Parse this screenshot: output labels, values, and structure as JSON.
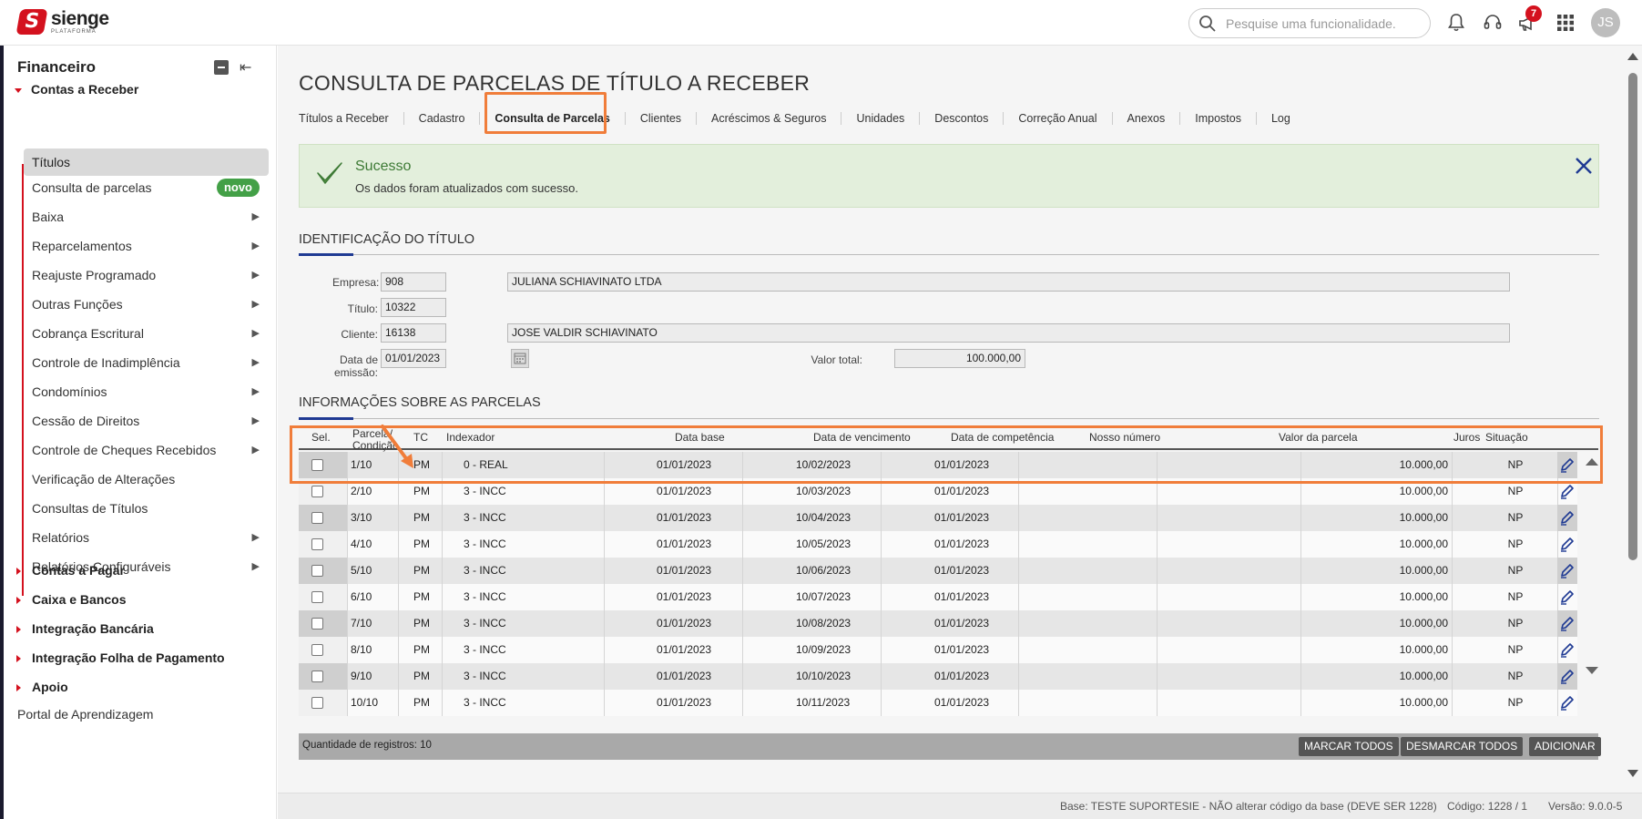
{
  "brand": {
    "name": "sienge",
    "sub": "PLATAFORMA",
    "mark": "S"
  },
  "header": {
    "search_placeholder": "Pesquise uma funcionalidade.",
    "notifications_badge": "7",
    "avatar_initials": "JS",
    "accent_color": "#d4111e"
  },
  "sidebar": {
    "title": "Financeiro",
    "sections": {
      "contas_receber": "Contas a Receber",
      "contas_pagar": "Contas a Pagar",
      "caixa_bancos": "Caixa e Bancos",
      "integracao_bancaria": "Integração Bancária",
      "integracao_folha": "Integração Folha de Pagamento",
      "apoio": "Apoio"
    },
    "items": [
      {
        "label": "Títulos",
        "active": true
      },
      {
        "label": "Consulta de parcelas",
        "badge": "novo"
      },
      {
        "label": "Baixa",
        "submenu": true
      },
      {
        "label": "Reparcelamentos",
        "submenu": true
      },
      {
        "label": "Reajuste Programado",
        "submenu": true
      },
      {
        "label": "Outras Funções",
        "submenu": true
      },
      {
        "label": "Cobrança Escritural",
        "submenu": true
      },
      {
        "label": "Controle de Inadimplência",
        "submenu": true
      },
      {
        "label": "Condomínios",
        "submenu": true
      },
      {
        "label": "Cessão de Direitos",
        "submenu": true
      },
      {
        "label": "Controle de Cheques Recebidos",
        "submenu": true
      },
      {
        "label": "Verificação de Alterações"
      },
      {
        "label": "Consultas de Títulos"
      },
      {
        "label": "Relatórios",
        "submenu": true
      },
      {
        "label": "Relatórios Configuráveis",
        "submenu": true
      }
    ],
    "portal": "Portal de Aprendizagem"
  },
  "page": {
    "title": "CONSULTA DE PARCELAS DE TÍTULO A RECEBER",
    "tabs": [
      "Títulos a Receber",
      "Cadastro",
      "Consulta de Parcelas",
      "Clientes",
      "Acréscimos & Seguros",
      "Unidades",
      "Descontos",
      "Correção Anual",
      "Anexos",
      "Impostos",
      "Log"
    ],
    "active_tab": "Consulta de Parcelas"
  },
  "alert": {
    "title": "Sucesso",
    "message": "Os dados foram atualizados com sucesso."
  },
  "identificacao": {
    "title": "IDENTIFICAÇÃO DO TÍTULO",
    "empresa_label": "Empresa:",
    "empresa_code": "908",
    "empresa_name": "JULIANA SCHIAVINATO LTDA",
    "titulo_label": "Título:",
    "titulo": "10322",
    "cliente_label": "Cliente:",
    "cliente_code": "16138",
    "cliente_name": "JOSE VALDIR SCHIAVINATO",
    "data_emissao_label": "Data de emissão:",
    "data_emissao": "01/01/2023",
    "valor_total_label": "Valor total:",
    "valor_total": "100.000,00"
  },
  "parcelas": {
    "title": "INFORMAÇÕES SOBRE AS PARCELAS",
    "columns": {
      "sel": "Sel.",
      "parcela": "Parcela/",
      "condicao": "Condição",
      "tc": "TC",
      "indexador": "Indexador",
      "data_base": "Data base",
      "data_vencimento": "Data de vencimento",
      "data_competencia": "Data de competência",
      "nosso_numero": "Nosso número",
      "valor_parcela": "Valor da parcela",
      "juros": "Juros",
      "situacao": "Situação"
    },
    "rows": [
      {
        "parcela": "1/10",
        "tc": "PM",
        "indexador": "0 - REAL",
        "data_base": "01/01/2023",
        "vencimento": "10/02/2023",
        "competencia": "01/01/2023",
        "nosso_numero": "",
        "valor": "10.000,00",
        "situacao": "NP"
      },
      {
        "parcela": "2/10",
        "tc": "PM",
        "indexador": "3 - INCC",
        "data_base": "01/01/2023",
        "vencimento": "10/03/2023",
        "competencia": "01/01/2023",
        "nosso_numero": "",
        "valor": "10.000,00",
        "situacao": "NP"
      },
      {
        "parcela": "3/10",
        "tc": "PM",
        "indexador": "3 - INCC",
        "data_base": "01/01/2023",
        "vencimento": "10/04/2023",
        "competencia": "01/01/2023",
        "nosso_numero": "",
        "valor": "10.000,00",
        "situacao": "NP"
      },
      {
        "parcela": "4/10",
        "tc": "PM",
        "indexador": "3 - INCC",
        "data_base": "01/01/2023",
        "vencimento": "10/05/2023",
        "competencia": "01/01/2023",
        "nosso_numero": "",
        "valor": "10.000,00",
        "situacao": "NP"
      },
      {
        "parcela": "5/10",
        "tc": "PM",
        "indexador": "3 - INCC",
        "data_base": "01/01/2023",
        "vencimento": "10/06/2023",
        "competencia": "01/01/2023",
        "nosso_numero": "",
        "valor": "10.000,00",
        "situacao": "NP"
      },
      {
        "parcela": "6/10",
        "tc": "PM",
        "indexador": "3 - INCC",
        "data_base": "01/01/2023",
        "vencimento": "10/07/2023",
        "competencia": "01/01/2023",
        "nosso_numero": "",
        "valor": "10.000,00",
        "situacao": "NP"
      },
      {
        "parcela": "7/10",
        "tc": "PM",
        "indexador": "3 - INCC",
        "data_base": "01/01/2023",
        "vencimento": "10/08/2023",
        "competencia": "01/01/2023",
        "nosso_numero": "",
        "valor": "10.000,00",
        "situacao": "NP"
      },
      {
        "parcela": "8/10",
        "tc": "PM",
        "indexador": "3 - INCC",
        "data_base": "01/01/2023",
        "vencimento": "10/09/2023",
        "competencia": "01/01/2023",
        "nosso_numero": "",
        "valor": "10.000,00",
        "situacao": "NP"
      },
      {
        "parcela": "9/10",
        "tc": "PM",
        "indexador": "3 - INCC",
        "data_base": "01/01/2023",
        "vencimento": "10/10/2023",
        "competencia": "01/01/2023",
        "nosso_numero": "",
        "valor": "10.000,00",
        "situacao": "NP"
      },
      {
        "parcela": "10/10",
        "tc": "PM",
        "indexador": "3 - INCC",
        "data_base": "01/01/2023",
        "vencimento": "10/11/2023",
        "competencia": "01/01/2023",
        "nosso_numero": "",
        "valor": "10.000,00",
        "situacao": "NP"
      }
    ],
    "footer_label": "Quantidade de registros:",
    "footer_count": "10",
    "buttons": {
      "marcar": "MARCAR TODOS",
      "desmarcar": "DESMARCAR TODOS",
      "adicionar": "ADICIONAR"
    }
  },
  "status": {
    "base": "Base: TESTE SUPORTESIE - NÃO alterar código da base (DEVE SER 1228)",
    "codigo": "Código: 1228 / 1",
    "versao": "Versão: 9.0.0-5"
  }
}
